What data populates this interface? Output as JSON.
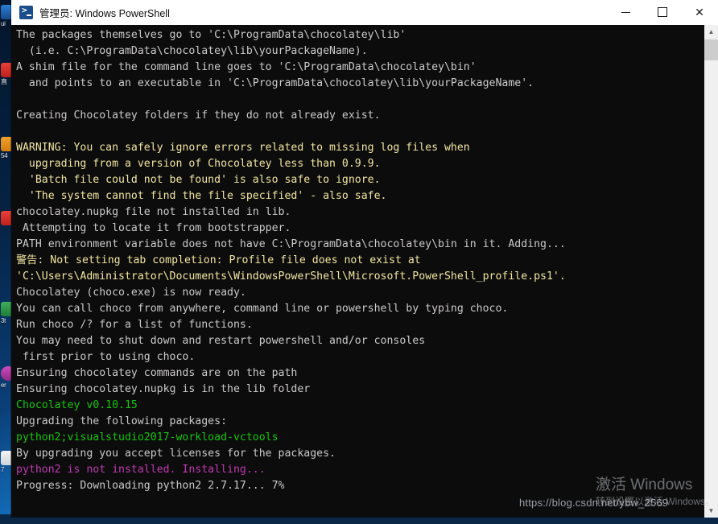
{
  "window": {
    "title": "管理员: Windows PowerShell",
    "icon": "powershell-icon",
    "controls": {
      "minimize": "—",
      "maximize": "☐",
      "close": "✕"
    }
  },
  "console": {
    "lines": [
      {
        "text": "The packages themselves go to 'C:\\ProgramData\\chocolatey\\lib'",
        "color": "white"
      },
      {
        "text": "  (i.e. C:\\ProgramData\\chocolatey\\lib\\yourPackageName).",
        "color": "white"
      },
      {
        "text": "A shim file for the command line goes to 'C:\\ProgramData\\chocolatey\\bin'",
        "color": "white"
      },
      {
        "text": "  and points to an executable in 'C:\\ProgramData\\chocolatey\\lib\\yourPackageName'.",
        "color": "white"
      },
      {
        "text": "",
        "color": "white"
      },
      {
        "text": "Creating Chocolatey folders if they do not already exist.",
        "color": "white"
      },
      {
        "text": "",
        "color": "white"
      },
      {
        "text": "WARNING: You can safely ignore errors related to missing log files when",
        "color": "yellow"
      },
      {
        "text": "  upgrading from a version of Chocolatey less than 0.9.9.",
        "color": "yellow"
      },
      {
        "text": "  'Batch file could not be found' is also safe to ignore.",
        "color": "yellow"
      },
      {
        "text": "  'The system cannot find the file specified' - also safe.",
        "color": "yellow"
      },
      {
        "text": "chocolatey.nupkg file not installed in lib.",
        "color": "white"
      },
      {
        "text": " Attempting to locate it from bootstrapper.",
        "color": "white"
      },
      {
        "text": "PATH environment variable does not have C:\\ProgramData\\chocolatey\\bin in it. Adding...",
        "color": "white"
      },
      {
        "text": "警告: Not setting tab completion: Profile file does not exist at",
        "color": "yellow"
      },
      {
        "text": "'C:\\Users\\Administrator\\Documents\\WindowsPowerShell\\Microsoft.PowerShell_profile.ps1'.",
        "color": "yellow"
      },
      {
        "text": "Chocolatey (choco.exe) is now ready.",
        "color": "white"
      },
      {
        "text": "You can call choco from anywhere, command line or powershell by typing choco.",
        "color": "white"
      },
      {
        "text": "Run choco /? for a list of functions.",
        "color": "white"
      },
      {
        "text": "You may need to shut down and restart powershell and/or consoles",
        "color": "white"
      },
      {
        "text": " first prior to using choco.",
        "color": "white"
      },
      {
        "text": "Ensuring chocolatey commands are on the path",
        "color": "white"
      },
      {
        "text": "Ensuring chocolatey.nupkg is in the lib folder",
        "color": "white"
      },
      {
        "text": "Chocolatey v0.10.15",
        "color": "green"
      },
      {
        "text": "Upgrading the following packages:",
        "color": "white"
      },
      {
        "text": "python2;visualstudio2017-workload-vctools",
        "color": "green"
      },
      {
        "text": "By upgrading you accept licenses for the packages.",
        "color": "white"
      },
      {
        "text": "python2 is not installed. Installing...",
        "color": "magenta"
      },
      {
        "text": "Progress: Downloading python2 2.7.17... 7%",
        "color": "white"
      }
    ]
  },
  "scrollbar": {
    "up_arrow": "▲",
    "down_arrow": "▼"
  },
  "watermarks": {
    "blog_url": "https://blog.csdn.net/ybw_2569",
    "activate_title": "激活 Windows",
    "activate_subtitle": "转到设置以激活 Windows。"
  },
  "desktop_icons": [
    {
      "label": "ui",
      "color": "blue"
    },
    {
      "label": "直",
      "color": "red"
    },
    {
      "label": "54",
      "color": "orange"
    },
    {
      "label": "3t",
      "color": "green"
    },
    {
      "label": "er",
      "color": "blue"
    },
    {
      "label": "7",
      "color": "white"
    }
  ],
  "colors": {
    "console_bg": "#0c0c0c",
    "white_text": "#cccccc",
    "yellow_text": "#f2e6a0",
    "green_text": "#16c60c",
    "magenta_text": "#c239b3",
    "titlebar_bg": "#ffffff"
  }
}
